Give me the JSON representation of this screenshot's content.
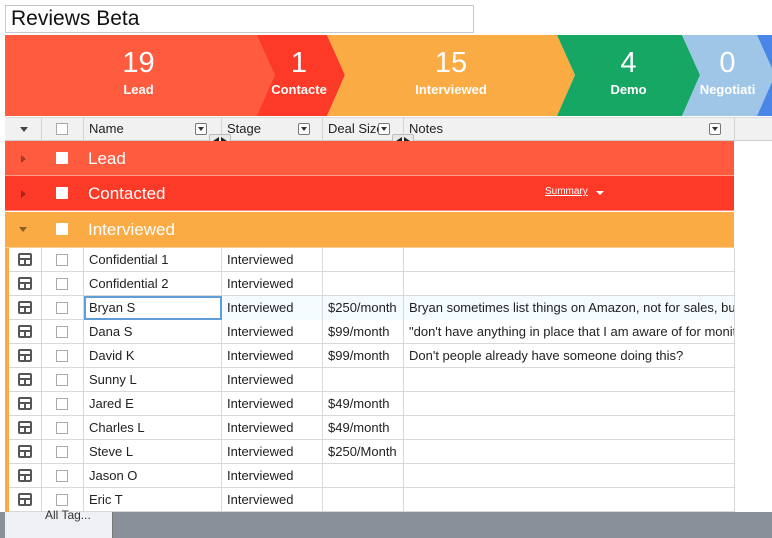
{
  "app": {
    "title": "Reviews Beta"
  },
  "pipeline": [
    {
      "count": "19",
      "label": "Lead",
      "color": "#fe5b3f"
    },
    {
      "count": "1",
      "label": "Contacte",
      "color": "#fd3a27"
    },
    {
      "count": "15",
      "label": "Interviewed",
      "color": "#fbab44"
    },
    {
      "count": "4",
      "label": "Demo",
      "color": "#16a765"
    },
    {
      "count": "0",
      "label": "Negotiati",
      "color": "#9fc6e7"
    }
  ],
  "columns": {
    "name": "Name",
    "stage": "Stage",
    "deal_size": "Deal Size",
    "notes": "Notes"
  },
  "groups": {
    "lead": {
      "label": "Lead",
      "color": "#fe5b3f"
    },
    "contacted": {
      "label": "Contacted",
      "color": "#fd3a27",
      "summary": "Summary"
    },
    "interviewed": {
      "label": "Interviewed",
      "color": "#fbab44"
    }
  },
  "rows": [
    {
      "name": "Confidential 1",
      "stage": "Interviewed",
      "deal": "",
      "notes": ""
    },
    {
      "name": "Confidential 2",
      "stage": "Interviewed",
      "deal": "",
      "notes": ""
    },
    {
      "name": "Bryan S",
      "stage": "Interviewed",
      "deal": "$250/month",
      "notes": "Bryan sometimes list things on Amazon, not for sales, bu"
    },
    {
      "name": "Dana S",
      "stage": "Interviewed",
      "deal": "$99/month",
      "notes": "\"don't have anything in place that I am aware of for monit"
    },
    {
      "name": "David K",
      "stage": "Interviewed",
      "deal": "$99/month",
      "notes": "Don't people already have someone doing this?"
    },
    {
      "name": "Sunny L",
      "stage": "Interviewed",
      "deal": "",
      "notes": ""
    },
    {
      "name": "Jared E",
      "stage": "Interviewed",
      "deal": "$49/month",
      "notes": ""
    },
    {
      "name": "Charles L",
      "stage": "Interviewed",
      "deal": "$49/month",
      "notes": ""
    },
    {
      "name": "Steve L",
      "stage": "Interviewed",
      "deal": "$250/Month",
      "notes": ""
    },
    {
      "name": "Jason O",
      "stage": "Interviewed",
      "deal": "",
      "notes": ""
    },
    {
      "name": "Eric T",
      "stage": "Interviewed",
      "deal": "",
      "notes": ""
    }
  ],
  "footer": {
    "tab_label": "All Tag..."
  }
}
